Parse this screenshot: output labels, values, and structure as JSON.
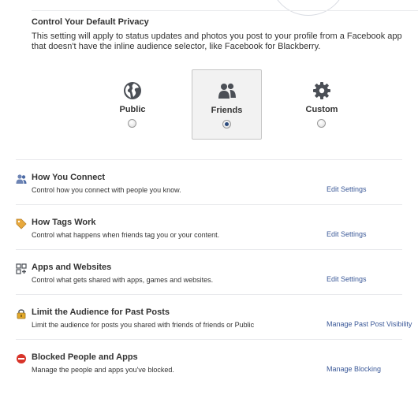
{
  "privacy": {
    "title": "Control Your Default Privacy",
    "description": "This setting will apply to status updates and photos you post to your profile from a Facebook app that doesn't have the inline audience selector, like Facebook for Blackberry.",
    "options": [
      {
        "label": "Public",
        "icon": "globe-icon",
        "selected": false
      },
      {
        "label": "Friends",
        "icon": "friends-icon",
        "selected": true
      },
      {
        "label": "Custom",
        "icon": "gear-icon",
        "selected": false
      }
    ]
  },
  "settings": [
    {
      "icon": "people-icon",
      "title": "How You Connect",
      "description": "Control how you connect with people you know.",
      "link": "Edit Settings"
    },
    {
      "icon": "tag-icon",
      "title": "How Tags Work",
      "description": "Control what happens when friends tag you or your content.",
      "link": "Edit Settings"
    },
    {
      "icon": "apps-icon",
      "title": "Apps and Websites",
      "description": "Control what gets shared with apps, games and websites.",
      "link": "Edit Settings"
    },
    {
      "icon": "lock-icon",
      "title": "Limit the Audience for Past Posts",
      "description": "Limit the audience for posts you shared with friends of friends or Public",
      "link": "Manage Past Post Visibility"
    },
    {
      "icon": "blocked-icon",
      "title": "Blocked People and Apps",
      "description": "Manage the people and apps you've blocked.",
      "link": "Manage Blocking"
    }
  ],
  "colors": {
    "link": "#3b5998",
    "icon_dark": "#4b4f56",
    "blocked": "#d8342a",
    "lock": "#e3a92a",
    "tag": "#e8a93d"
  }
}
